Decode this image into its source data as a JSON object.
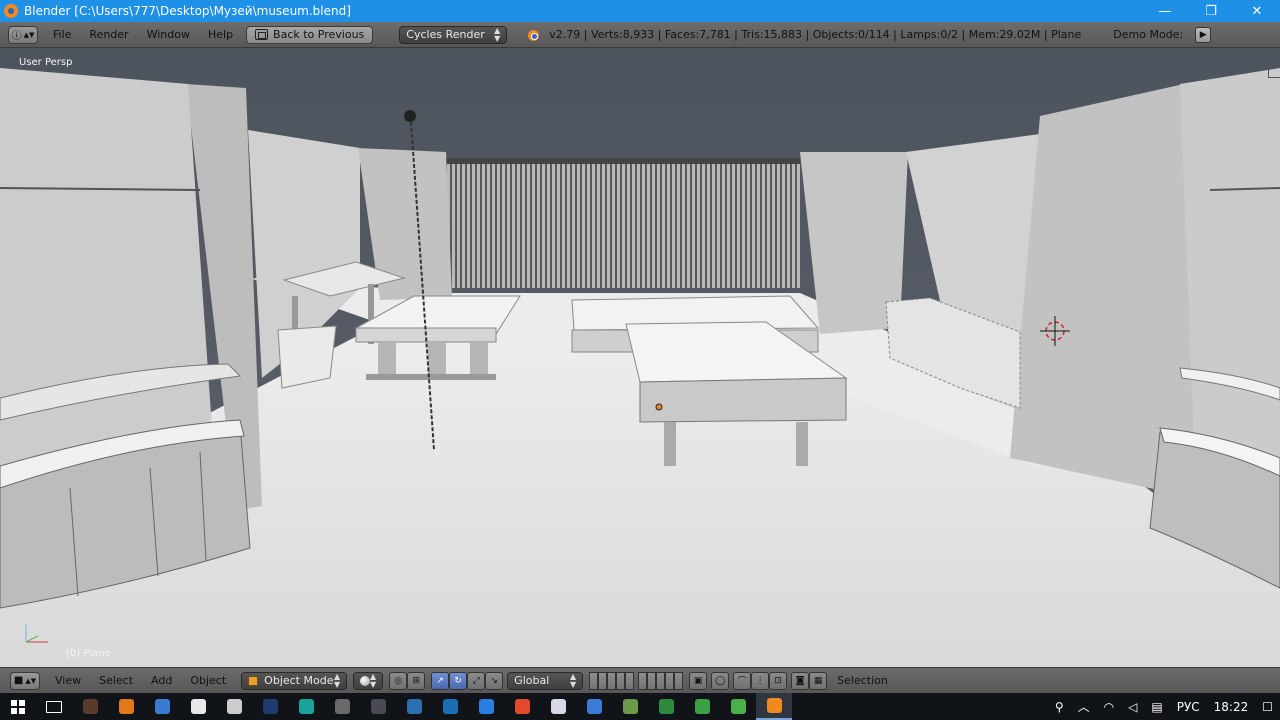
{
  "window": {
    "title": "Blender [C:\\Users\\777\\Desktop\\Музей\\museum.blend]",
    "minimize": "—",
    "maximize": "❐",
    "close": "✕"
  },
  "menu": {
    "file": "File",
    "render": "Render",
    "window": "Window",
    "help": "Help",
    "back_to_previous": "Back to Previous"
  },
  "render_engine": "Cycles Render",
  "stats": "v2.79 | Verts:8,933 | Faces:7,781 | Tris:15,883 | Objects:0/114 | Lamps:0/2 | Mem:29.02M | Plane",
  "demo_mode": "Demo Mode:",
  "viewport": {
    "view_name": "User Persp",
    "active_object": "(0) Plane"
  },
  "view3d_header": {
    "view": "View",
    "select": "Select",
    "add": "Add",
    "object": "Object",
    "mode": "Object Mode",
    "orientation": "Global",
    "selection": "Selection"
  },
  "taskbar": {
    "language": "РУС",
    "time": "18:22",
    "apps": [
      {
        "icon": "shield-icon",
        "color": "#5a3a2a"
      },
      {
        "icon": "flame-icon",
        "color": "#e07a18"
      },
      {
        "icon": "refresh-icon",
        "color": "#3a7ad0"
      },
      {
        "icon": "document-icon",
        "color": "#e8e8e8"
      },
      {
        "icon": "media-icon",
        "color": "#cccccc"
      },
      {
        "icon": "photoshop-icon",
        "color": "#1e3a6e"
      },
      {
        "icon": "teal-app-icon",
        "color": "#1aa39a"
      },
      {
        "icon": "image-editor-icon",
        "color": "#6a6a6a"
      },
      {
        "icon": "steam-icon",
        "color": "#4a4a55"
      },
      {
        "icon": "play-icon",
        "color": "#2b6fb0"
      },
      {
        "icon": "box-app-icon",
        "color": "#1a6fb3"
      },
      {
        "icon": "paint-icon",
        "color": "#2a7de1"
      },
      {
        "icon": "chrome-icon",
        "color": "#e24a2d"
      },
      {
        "icon": "notepad-icon",
        "color": "#d8d8e8"
      },
      {
        "icon": "photos-icon",
        "color": "#3b7bd8"
      },
      {
        "icon": "gallery-icon",
        "color": "#6b9a4a"
      },
      {
        "icon": "folder-green-icon",
        "color": "#2e8a3e"
      },
      {
        "icon": "folder-leaf-icon",
        "color": "#3da044"
      },
      {
        "icon": "file-green-icon",
        "color": "#4ab04e"
      },
      {
        "icon": "blender-icon",
        "color": "#f08a1c"
      }
    ]
  }
}
